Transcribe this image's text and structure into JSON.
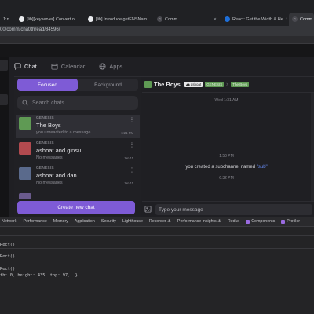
{
  "browser": {
    "tabs": [
      {
        "label": "1:n",
        "icon": "page-icon"
      },
      {
        "label": "[lib][keyserver] Convert o",
        "icon": "github-icon"
      },
      {
        "label": "[lib] Introduce getENSNam",
        "icon": "github-icon"
      },
      {
        "label": "Comm",
        "icon": "comm-icon"
      },
      {
        "label": "React: Get the Width & He",
        "icon": "react-icon"
      },
      {
        "label": "Comm",
        "icon": "comm-icon"
      }
    ],
    "url": "00/comm/chat/thread/84596/"
  },
  "nav": {
    "tabs": [
      {
        "label": "Chat",
        "icon": "chat-bubble-icon"
      },
      {
        "label": "Calendar",
        "icon": "calendar-icon"
      },
      {
        "label": "Apps",
        "icon": "globe-icon"
      }
    ]
  },
  "chatlist": {
    "toggle": {
      "focused": "Focused",
      "background": "Background"
    },
    "search_placeholder": "Search chats",
    "threads": [
      {
        "community": "GENESIS",
        "name": "The Boys",
        "last": "you unreacted to a message",
        "date": "6:21 PM",
        "color": "#5f9a54"
      },
      {
        "community": "GENESIS",
        "name": "ashoat and ginsu",
        "last": "No messages",
        "date": "Jan 11",
        "color": "#b24a4f"
      },
      {
        "community": "GENESIS",
        "name": "ashoat and dan",
        "last": "No messages",
        "date": "Jan 11",
        "color": "#5a6a8c"
      }
    ],
    "new_chat": "Create new chat"
  },
  "chat": {
    "title": "The Boys",
    "member_pill": "ashoat",
    "community_pill": "GENESIS",
    "breadcrumb_sep": ">",
    "channel_pill": "The Boys",
    "messages": {
      "time1": "Wed 1:31 AM",
      "time2": "1:50 PM",
      "sys_text": "you created a subchannel named ",
      "sys_link": "\"sub\"",
      "time3": "6:32 PM"
    },
    "composer_placeholder": "Type your message"
  },
  "devtools": {
    "tabs": [
      {
        "label": "Network"
      },
      {
        "label": "Performance"
      },
      {
        "label": "Memory"
      },
      {
        "label": "Application"
      },
      {
        "label": "Security"
      },
      {
        "label": "Lighthouse"
      },
      {
        "label": "Recorder ⚓"
      },
      {
        "label": "Performance insights ⚓"
      },
      {
        "label": "Redux"
      },
      {
        "label": "Components",
        "square": true
      },
      {
        "label": "Profiler",
        "square": true
      }
    ],
    "console": [
      "Rect()",
      "Rect()",
      "Rect()",
      "th: 0, height: 435, top: 97, …}"
    ]
  },
  "colors": {
    "accent": "#7e5bd6",
    "genesis_green": "#5f9a54",
    "link": "#6a91ff"
  }
}
